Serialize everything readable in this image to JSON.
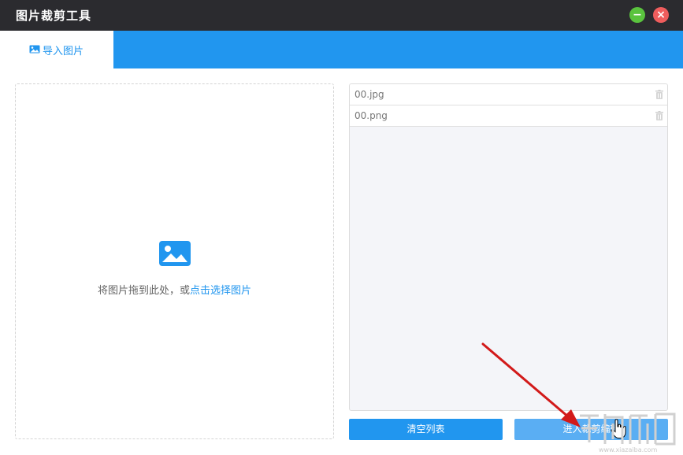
{
  "window": {
    "title": "图片裁剪工具",
    "minimize_glyph": "−",
    "close_glyph": "×"
  },
  "tabs": [
    {
      "label": "导入图片",
      "icon": "image-icon",
      "active": true
    }
  ],
  "dropzone": {
    "icon": "image-icon",
    "text": "将图片拖到此处，或",
    "link_text": "点击选择图片"
  },
  "file_list": {
    "items": [
      {
        "name": "00.jpg",
        "action_icon": "trash-icon"
      },
      {
        "name": "00.png",
        "action_icon": "trash-icon"
      }
    ]
  },
  "actions": {
    "clear_label": "清空列表",
    "enter_label": "进入裁剪编辑"
  },
  "watermark": {
    "text": "www.xiazaiba.com"
  },
  "colors": {
    "accent": "#2196ef",
    "titlebar": "#2b2b2f",
    "minimize": "#5ac33e",
    "close": "#ef5d5d",
    "annotation_arrow": "#d21a1a"
  }
}
